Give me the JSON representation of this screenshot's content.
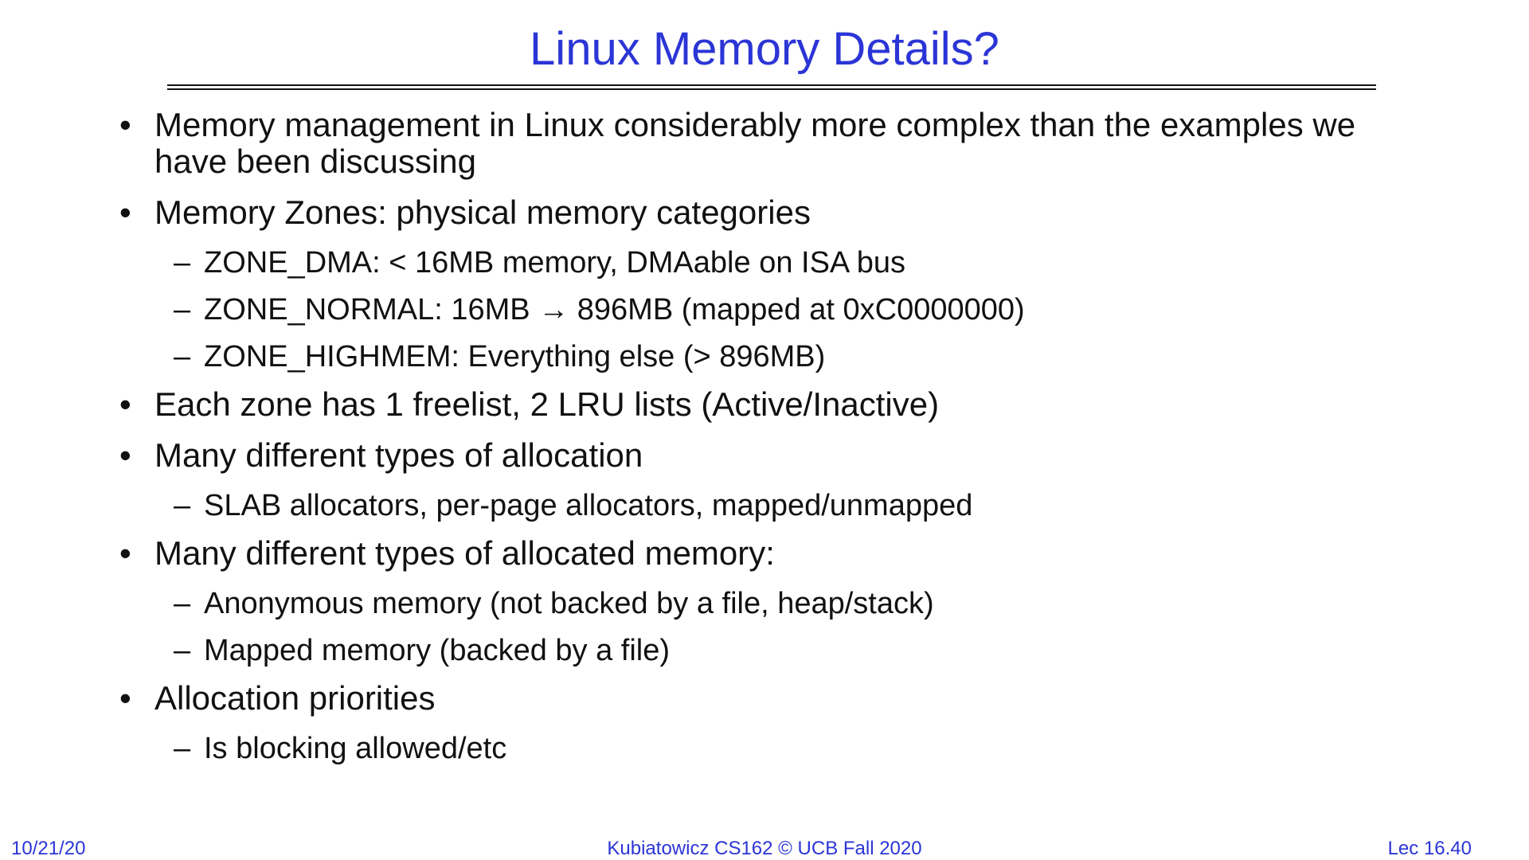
{
  "slide": {
    "title": "Linux Memory Details?",
    "bullets": [
      {
        "symbol": "•",
        "text": "Memory management in Linux considerably more complex than the examples we have been discussing"
      },
      {
        "symbol": "•",
        "text": "Memory Zones: physical memory categories"
      },
      {
        "symbol": "–",
        "text": "ZONE_DMA: < 16MB memory, DMAable on ISA bus"
      },
      {
        "symbol": "–",
        "text": "ZONE_NORMAL: 16MB → 896MB (mapped at 0xC0000000)"
      },
      {
        "symbol": "–",
        "text": "ZONE_HIGHMEM: Everything else (> 896MB)"
      },
      {
        "symbol": "•",
        "text": "Each zone has 1 freelist, 2 LRU lists (Active/Inactive)"
      },
      {
        "symbol": "•",
        "text": "Many different types of allocation"
      },
      {
        "symbol": "–",
        "text": "SLAB allocators, per-page allocators, mapped/unmapped"
      },
      {
        "symbol": "•",
        "text": "Many different types of allocated memory:"
      },
      {
        "symbol": "–",
        "text": "Anonymous memory (not backed by a file, heap/stack)"
      },
      {
        "symbol": "–",
        "text": "Mapped memory (backed by a file)"
      },
      {
        "symbol": "•",
        "text": "Allocation priorities"
      },
      {
        "symbol": "–",
        "text": "Is blocking allowed/etc"
      }
    ]
  },
  "footer": {
    "date": "10/21/20",
    "course": "Kubiatowicz CS162 © UCB Fall 2020",
    "lecture": "Lec 16.40"
  },
  "colors": {
    "accent": "#2b35d6",
    "text": "#111111",
    "background": "#ffffff"
  }
}
